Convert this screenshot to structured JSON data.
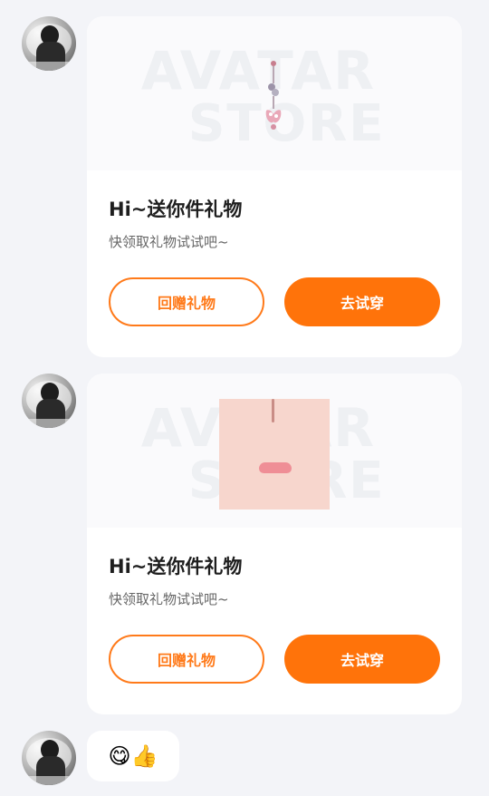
{
  "messages": [
    {
      "type": "gift",
      "title": "Hi~送你件礼物",
      "subtitle": "快领取礼物试试吧~",
      "watermark_top": "AVATAR",
      "watermark_bottom": "STORE",
      "buttons": {
        "return_gift": "回赠礼物",
        "try_on": "去试穿"
      }
    },
    {
      "type": "gift",
      "title": "Hi~送你件礼物",
      "subtitle": "快领取礼物试试吧~",
      "watermark_top": "AVATAR",
      "watermark_bottom": "STORE",
      "buttons": {
        "return_gift": "回赠礼物",
        "try_on": "去试穿"
      }
    },
    {
      "type": "emoji",
      "emoji_text": "😋👍"
    }
  ],
  "theme": {
    "background": "#F3F4F8",
    "accent": "#FF730A"
  }
}
